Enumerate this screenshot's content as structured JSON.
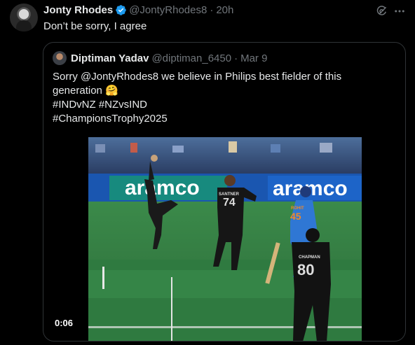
{
  "tweet": {
    "author_name": "Jonty Rhodes",
    "handle": "@JontyRhodes8",
    "separator": "·",
    "time": "20h",
    "text": "Don’t be sorry, I agree"
  },
  "quote": {
    "author_name": "Diptiman Yadav",
    "handle": "@diptiman_6450",
    "separator": "·",
    "time": "Mar 9",
    "lines": [
      "Sorry @JontyRhodes8 we believe in Philips best fielder of this",
      "generation",
      "#INDvNZ #NZvsIND",
      "#ChampionsTrophy2025"
    ],
    "emoji": "🤗",
    "video": {
      "duration": "0:06",
      "board_text_1": "aramco",
      "board_text_2": "aramco",
      "player_1_name": "SANTNER",
      "player_1_number": "74",
      "player_2_name": "ROHIT",
      "player_2_number": "45",
      "player_3_name": "CHAPMAN",
      "player_3_number": "80"
    }
  },
  "icons": {
    "verified": "verified-badge-icon",
    "grok": "grok-icon",
    "more": "more-icon"
  },
  "colors": {
    "background": "#000000",
    "text_primary": "#e7e9ea",
    "text_secondary": "#71767b",
    "verified_blue": "#1d9bf0",
    "border": "#2f3336"
  }
}
